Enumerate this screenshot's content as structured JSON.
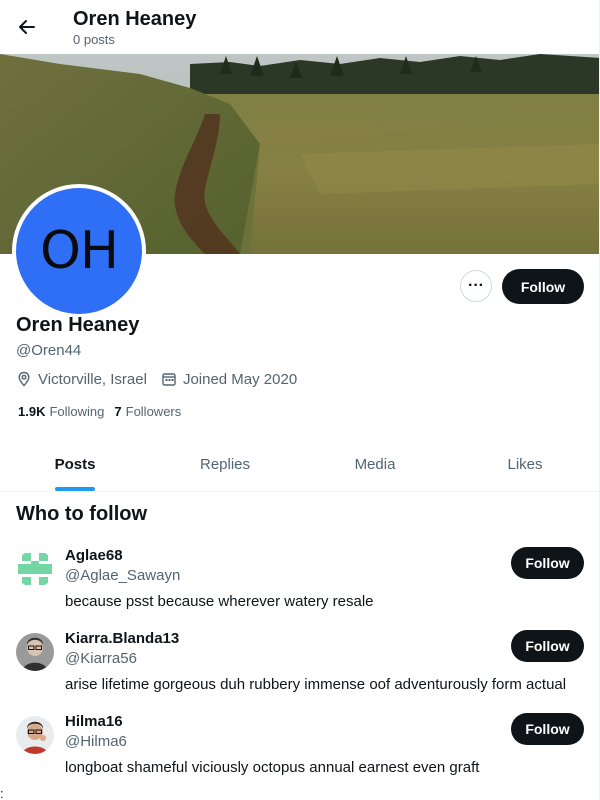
{
  "header": {
    "title": "Oren Heaney",
    "subtitle": "0 posts"
  },
  "profile": {
    "avatar_initials": "OH",
    "avatar_color": "#2f6ff5",
    "display_name": "Oren Heaney",
    "handle": "@Oren44",
    "location": "Victorville, Israel",
    "joined": "Joined May 2020",
    "following_count": "1.9K",
    "following_label": "Following",
    "followers_count": "7",
    "followers_label": "Followers",
    "more_label": "···",
    "follow_label": "Follow"
  },
  "tabs": [
    {
      "label": "Posts",
      "active": true
    },
    {
      "label": "Replies",
      "active": false
    },
    {
      "label": "Media",
      "active": false
    },
    {
      "label": "Likes",
      "active": false
    }
  ],
  "who_to_follow": {
    "title": "Who to follow",
    "users": [
      {
        "name": "Aglae68",
        "handle": "@Aglae_Sawayn",
        "bio": "because psst because wherever watery resale",
        "follow_label": "Follow"
      },
      {
        "name": "Kiarra.Blanda13",
        "handle": "@Kiarra56",
        "bio": "arise lifetime gorgeous duh rubbery immense oof adventurously form actual",
        "follow_label": "Follow"
      },
      {
        "name": "Hilma16",
        "handle": "@Hilma6",
        "bio": "longboat shameful viciously octopus annual earnest even graft",
        "follow_label": "Follow"
      }
    ]
  },
  "stray_text": ":",
  "colors": {
    "accent": "#1d9bf0",
    "button_dark": "#0f1419",
    "secondary_text": "#536471"
  }
}
